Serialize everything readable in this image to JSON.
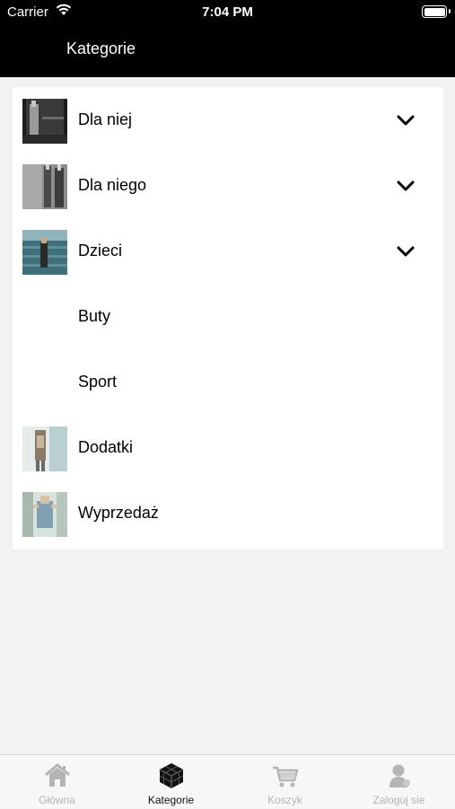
{
  "status_bar": {
    "carrier": "Carrier",
    "time": "7:04 PM"
  },
  "header": {
    "title": "Kategorie"
  },
  "categories": [
    {
      "label": "Dla niej",
      "has_thumb": true,
      "expandable": true
    },
    {
      "label": "Dla niego",
      "has_thumb": true,
      "expandable": true
    },
    {
      "label": "Dzieci",
      "has_thumb": true,
      "expandable": true
    },
    {
      "label": "Buty",
      "has_thumb": false,
      "expandable": false
    },
    {
      "label": "Sport",
      "has_thumb": false,
      "expandable": false
    },
    {
      "label": "Dodatki",
      "has_thumb": true,
      "expandable": false
    },
    {
      "label": "Wyprzedaż",
      "has_thumb": true,
      "expandable": false
    }
  ],
  "tabbar": {
    "tabs": [
      {
        "label": "Główna",
        "icon": "home-icon",
        "active": false
      },
      {
        "label": "Kategorie",
        "icon": "cube-grid-icon",
        "active": true
      },
      {
        "label": "Koszyk",
        "icon": "cart-icon",
        "active": false
      },
      {
        "label": "Zaloguj sie",
        "icon": "user-icon",
        "active": false
      }
    ]
  },
  "colors": {
    "header_bg": "#000000",
    "page_bg": "#f2f2f2",
    "active_tab": "#111111",
    "inactive_tab": "#b5b5b5"
  }
}
